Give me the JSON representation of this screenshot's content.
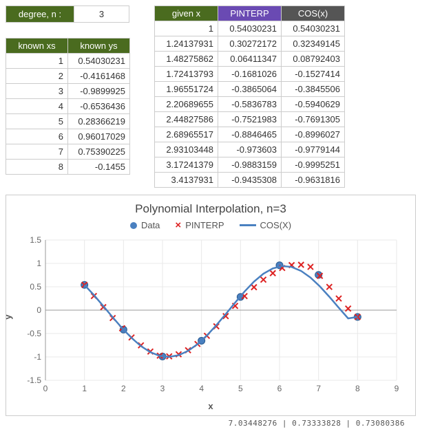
{
  "degree": {
    "label": "degree, n :",
    "value": "3"
  },
  "known": {
    "headers": [
      "known xs",
      "known ys"
    ],
    "rows": [
      [
        "1",
        "0.54030231"
      ],
      [
        "2",
        "-0.4161468"
      ],
      [
        "3",
        "-0.9899925"
      ],
      [
        "4",
        "-0.6536436"
      ],
      [
        "5",
        "0.28366219"
      ],
      [
        "6",
        "0.96017029"
      ],
      [
        "7",
        "0.75390225"
      ],
      [
        "8",
        "-0.1455"
      ]
    ]
  },
  "given": {
    "headers": [
      "given x",
      "PINTERP",
      "COS(x)"
    ],
    "rows": [
      [
        "1",
        "0.54030231",
        "0.54030231"
      ],
      [
        "1.24137931",
        "0.30272172",
        "0.32349145"
      ],
      [
        "1.48275862",
        "0.06411347",
        "0.08792403"
      ],
      [
        "1.72413793",
        "-0.1681026",
        "-0.1527414"
      ],
      [
        "1.96551724",
        "-0.3865064",
        "-0.3845506"
      ],
      [
        "2.20689655",
        "-0.5836783",
        "-0.5940629"
      ],
      [
        "2.44827586",
        "-0.7521983",
        "-0.7691305"
      ],
      [
        "2.68965517",
        "-0.8846465",
        "-0.8996027"
      ],
      [
        "2.93103448",
        "-0.973603",
        "-0.9779144"
      ],
      [
        "3.17241379",
        "-0.9883159",
        "-0.9995251"
      ],
      [
        "3.4137931",
        "-0.9435308",
        "-0.9631816"
      ]
    ]
  },
  "chart": {
    "title": "Polynomial Interpolation, n=3",
    "legend": {
      "data": "Data",
      "pinterp": "PINTERP",
      "cos": "COS(X)"
    },
    "ylabel": "y",
    "xlabel": "x",
    "xticks": [
      0,
      1,
      2,
      3,
      4,
      5,
      6,
      7,
      8,
      9
    ],
    "yticks": [
      -1.5,
      -1,
      -0.5,
      0,
      0.5,
      1,
      1.5
    ]
  },
  "chart_data": {
    "type": "line",
    "title": "Polynomial Interpolation, n=3",
    "xlabel": "x",
    "ylabel": "y",
    "xlim": [
      0,
      9
    ],
    "ylim": [
      -1.5,
      1.5
    ],
    "series": [
      {
        "name": "Data",
        "style": "scatter-dot",
        "x": [
          1,
          2,
          3,
          4,
          5,
          6,
          7,
          8
        ],
        "y": [
          0.54030231,
          -0.4161468,
          -0.9899925,
          -0.6536436,
          0.28366219,
          0.96017029,
          0.75390225,
          -0.1455
        ]
      },
      {
        "name": "PINTERP",
        "style": "scatter-x",
        "x": [
          1,
          1.24137931,
          1.48275862,
          1.72413793,
          1.96551724,
          2.20689655,
          2.44827586,
          2.68965517,
          2.93103448,
          3.17241379,
          3.4137931,
          3.65517241,
          3.89655172,
          4.13793103,
          4.37931034,
          4.62068966,
          4.86206897,
          5.10344828,
          5.34482759,
          5.5862069,
          5.82758621,
          6.06896552,
          6.31034483,
          6.55172414,
          6.79310345,
          7.03448276,
          7.27586207,
          7.51724138,
          7.75862069,
          8
        ],
        "y": [
          0.5403,
          0.3027,
          0.0641,
          -0.1681,
          -0.3865,
          -0.5837,
          -0.7522,
          -0.8846,
          -0.9736,
          -0.9883,
          -0.9435,
          -0.8571,
          -0.7234,
          -0.5486,
          -0.3456,
          -0.1277,
          0.0912,
          0.3008,
          0.4908,
          0.6517,
          0.7907,
          0.9015,
          0.9633,
          0.9705,
          0.9252,
          0.7333,
          0.4969,
          0.2494,
          0.0343,
          -0.1455
        ]
      },
      {
        "name": "COS(X)",
        "style": "line",
        "x": [
          1,
          1.24137931,
          1.48275862,
          1.72413793,
          1.96551724,
          2.20689655,
          2.44827586,
          2.68965517,
          2.93103448,
          3.17241379,
          3.4137931,
          3.65517241,
          3.89655172,
          4.13793103,
          4.37931034,
          4.62068966,
          4.86206897,
          5.10344828,
          5.34482759,
          5.5862069,
          5.82758621,
          6.06896552,
          6.31034483,
          6.55172414,
          6.79310345,
          7.03448276,
          7.27586207,
          7.51724138,
          7.75862069,
          8
        ],
        "y": [
          0.5403,
          0.3235,
          0.0879,
          -0.1527,
          -0.3846,
          -0.5941,
          -0.7691,
          -0.8996,
          -0.9779,
          -0.9995,
          -0.9632,
          -0.8708,
          -0.7276,
          -0.5416,
          -0.3232,
          -0.0846,
          0.1605,
          0.3982,
          0.61,
          0.7793,
          0.8929,
          0.9422,
          0.9237,
          0.8395,
          0.6968,
          0.5076,
          0.2872,
          0.0532,
          -0.1762,
          -0.1455
        ]
      }
    ]
  },
  "cut_row": "7.03448276 | 0.73333828 | 0.73080386"
}
